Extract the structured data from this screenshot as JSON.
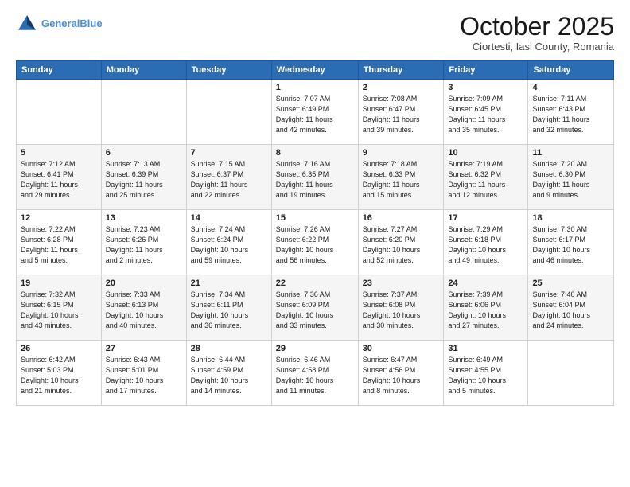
{
  "header": {
    "logo_line1": "General",
    "logo_line2": "Blue",
    "month": "October 2025",
    "location": "Ciortesti, Iasi County, Romania"
  },
  "days_of_week": [
    "Sunday",
    "Monday",
    "Tuesday",
    "Wednesday",
    "Thursday",
    "Friday",
    "Saturday"
  ],
  "weeks": [
    [
      {
        "day": "",
        "info": ""
      },
      {
        "day": "",
        "info": ""
      },
      {
        "day": "",
        "info": ""
      },
      {
        "day": "1",
        "info": "Sunrise: 7:07 AM\nSunset: 6:49 PM\nDaylight: 11 hours\nand 42 minutes."
      },
      {
        "day": "2",
        "info": "Sunrise: 7:08 AM\nSunset: 6:47 PM\nDaylight: 11 hours\nand 39 minutes."
      },
      {
        "day": "3",
        "info": "Sunrise: 7:09 AM\nSunset: 6:45 PM\nDaylight: 11 hours\nand 35 minutes."
      },
      {
        "day": "4",
        "info": "Sunrise: 7:11 AM\nSunset: 6:43 PM\nDaylight: 11 hours\nand 32 minutes."
      }
    ],
    [
      {
        "day": "5",
        "info": "Sunrise: 7:12 AM\nSunset: 6:41 PM\nDaylight: 11 hours\nand 29 minutes."
      },
      {
        "day": "6",
        "info": "Sunrise: 7:13 AM\nSunset: 6:39 PM\nDaylight: 11 hours\nand 25 minutes."
      },
      {
        "day": "7",
        "info": "Sunrise: 7:15 AM\nSunset: 6:37 PM\nDaylight: 11 hours\nand 22 minutes."
      },
      {
        "day": "8",
        "info": "Sunrise: 7:16 AM\nSunset: 6:35 PM\nDaylight: 11 hours\nand 19 minutes."
      },
      {
        "day": "9",
        "info": "Sunrise: 7:18 AM\nSunset: 6:33 PM\nDaylight: 11 hours\nand 15 minutes."
      },
      {
        "day": "10",
        "info": "Sunrise: 7:19 AM\nSunset: 6:32 PM\nDaylight: 11 hours\nand 12 minutes."
      },
      {
        "day": "11",
        "info": "Sunrise: 7:20 AM\nSunset: 6:30 PM\nDaylight: 11 hours\nand 9 minutes."
      }
    ],
    [
      {
        "day": "12",
        "info": "Sunrise: 7:22 AM\nSunset: 6:28 PM\nDaylight: 11 hours\nand 5 minutes."
      },
      {
        "day": "13",
        "info": "Sunrise: 7:23 AM\nSunset: 6:26 PM\nDaylight: 11 hours\nand 2 minutes."
      },
      {
        "day": "14",
        "info": "Sunrise: 7:24 AM\nSunset: 6:24 PM\nDaylight: 10 hours\nand 59 minutes."
      },
      {
        "day": "15",
        "info": "Sunrise: 7:26 AM\nSunset: 6:22 PM\nDaylight: 10 hours\nand 56 minutes."
      },
      {
        "day": "16",
        "info": "Sunrise: 7:27 AM\nSunset: 6:20 PM\nDaylight: 10 hours\nand 52 minutes."
      },
      {
        "day": "17",
        "info": "Sunrise: 7:29 AM\nSunset: 6:18 PM\nDaylight: 10 hours\nand 49 minutes."
      },
      {
        "day": "18",
        "info": "Sunrise: 7:30 AM\nSunset: 6:17 PM\nDaylight: 10 hours\nand 46 minutes."
      }
    ],
    [
      {
        "day": "19",
        "info": "Sunrise: 7:32 AM\nSunset: 6:15 PM\nDaylight: 10 hours\nand 43 minutes."
      },
      {
        "day": "20",
        "info": "Sunrise: 7:33 AM\nSunset: 6:13 PM\nDaylight: 10 hours\nand 40 minutes."
      },
      {
        "day": "21",
        "info": "Sunrise: 7:34 AM\nSunset: 6:11 PM\nDaylight: 10 hours\nand 36 minutes."
      },
      {
        "day": "22",
        "info": "Sunrise: 7:36 AM\nSunset: 6:09 PM\nDaylight: 10 hours\nand 33 minutes."
      },
      {
        "day": "23",
        "info": "Sunrise: 7:37 AM\nSunset: 6:08 PM\nDaylight: 10 hours\nand 30 minutes."
      },
      {
        "day": "24",
        "info": "Sunrise: 7:39 AM\nSunset: 6:06 PM\nDaylight: 10 hours\nand 27 minutes."
      },
      {
        "day": "25",
        "info": "Sunrise: 7:40 AM\nSunset: 6:04 PM\nDaylight: 10 hours\nand 24 minutes."
      }
    ],
    [
      {
        "day": "26",
        "info": "Sunrise: 6:42 AM\nSunset: 5:03 PM\nDaylight: 10 hours\nand 21 minutes."
      },
      {
        "day": "27",
        "info": "Sunrise: 6:43 AM\nSunset: 5:01 PM\nDaylight: 10 hours\nand 17 minutes."
      },
      {
        "day": "28",
        "info": "Sunrise: 6:44 AM\nSunset: 4:59 PM\nDaylight: 10 hours\nand 14 minutes."
      },
      {
        "day": "29",
        "info": "Sunrise: 6:46 AM\nSunset: 4:58 PM\nDaylight: 10 hours\nand 11 minutes."
      },
      {
        "day": "30",
        "info": "Sunrise: 6:47 AM\nSunset: 4:56 PM\nDaylight: 10 hours\nand 8 minutes."
      },
      {
        "day": "31",
        "info": "Sunrise: 6:49 AM\nSunset: 4:55 PM\nDaylight: 10 hours\nand 5 minutes."
      },
      {
        "day": "",
        "info": ""
      }
    ]
  ]
}
